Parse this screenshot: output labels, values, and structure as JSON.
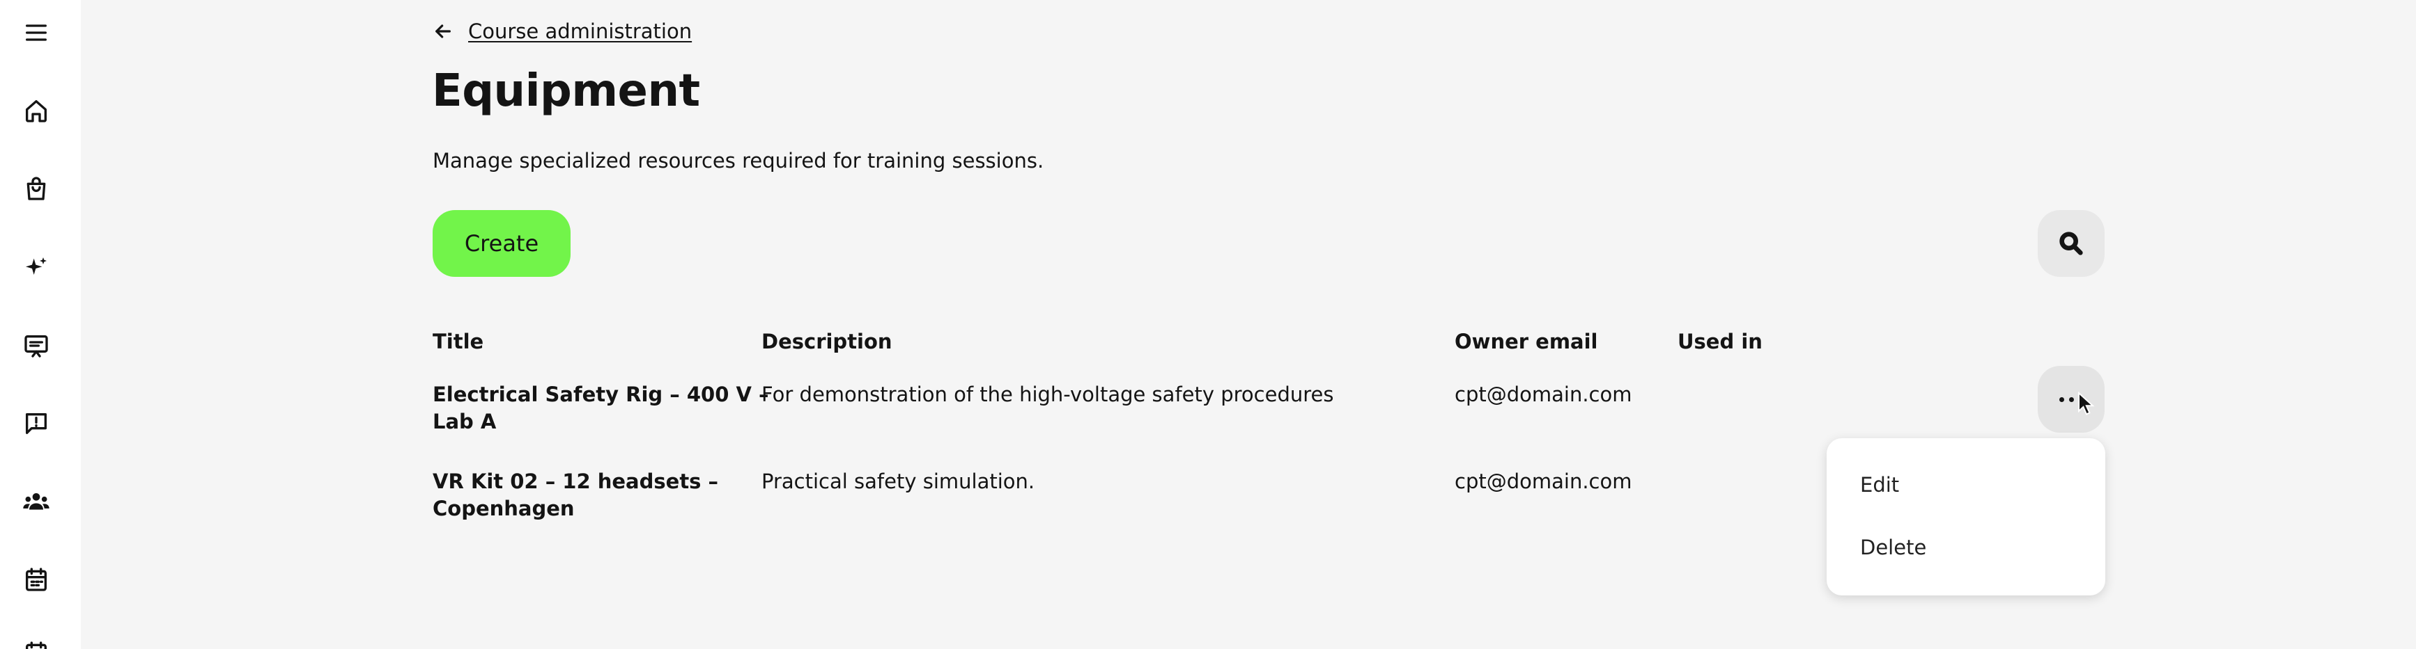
{
  "sidebar": {
    "icons": [
      "menu-icon",
      "home-icon",
      "shopping-bag-icon",
      "sparkles-icon",
      "presentation-icon",
      "message-alert-icon",
      "users-icon",
      "calendar-icon"
    ]
  },
  "header": {
    "back_label": "Course administration",
    "title": "Equipment",
    "description": "Manage specialized resources required for training sessions."
  },
  "toolbar": {
    "create_label": "Create"
  },
  "table": {
    "columns": [
      "Title",
      "Description",
      "Owner email",
      "Used in"
    ],
    "rows": [
      {
        "title_line1": "Electrical Safety Rig – 400 V –",
        "title_line2": "Lab A",
        "description": "For demonstration of the high-voltage safety procedures",
        "owner_email": "cpt@domain.com",
        "used_in": ""
      },
      {
        "title_line1": "VR Kit 02 – 12 headsets –",
        "title_line2": "Copenhagen",
        "description": "Practical safety simulation.",
        "owner_email": "cpt@domain.com",
        "used_in": ""
      }
    ]
  },
  "context_menu": {
    "items": [
      "Edit",
      "Delete"
    ]
  },
  "colors": {
    "accent": "#72f44a",
    "background": "#f5f5f5"
  }
}
